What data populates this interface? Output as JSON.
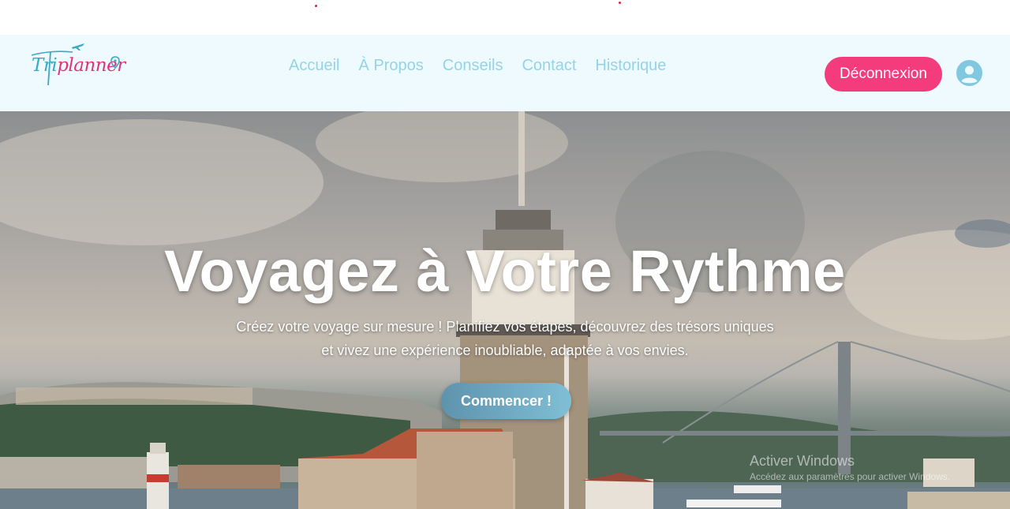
{
  "brand": {
    "name_part1": "Tri",
    "name_part2": "planner",
    "logo_icons": [
      "airplane-icon",
      "location-pin-icon"
    ]
  },
  "nav": {
    "links": [
      {
        "label": "Accueil"
      },
      {
        "label": "À Propos"
      },
      {
        "label": "Conseils"
      },
      {
        "label": "Contact"
      },
      {
        "label": "Historique"
      }
    ],
    "logout_label": "Déconnexion",
    "avatar_icon": "user-avatar-icon"
  },
  "hero": {
    "title": "Voyagez à Votre Rythme",
    "subtitle_line1": "Créez votre voyage sur mesure ! Planifiez vos étapes, découvrez des trésors uniques",
    "subtitle_line2": "et vivez une expérience inoubliable, adaptée à vos envies.",
    "cta_label": "Commencer !"
  },
  "os_watermark": {
    "line1": "Activer Windows",
    "line2": "Accédez aux paramètres pour activer Windows."
  },
  "colors": {
    "navbar_bg": "#eefafd",
    "nav_link": "#93d4e8",
    "logout_bg": "#f43b7c",
    "cta_bg": "#6ba9c2",
    "brand_teal": "#3aa9c4",
    "brand_pink": "#e0337a"
  }
}
